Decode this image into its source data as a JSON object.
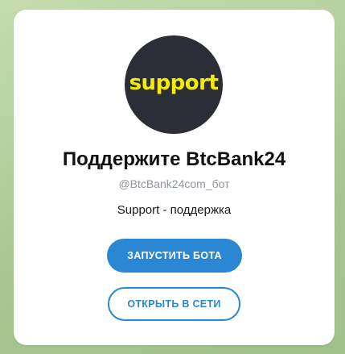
{
  "bot": {
    "avatar_text": "support",
    "title": "Поддержите BtcBank24",
    "username": "@BtcBank24com_бот",
    "description": "Support - поддержка"
  },
  "actions": {
    "start_label": "ЗАПУСТИТЬ БОТА",
    "open_web_label": "ОТКРЫТЬ В СЕТИ"
  },
  "colors": {
    "accent": "#2b87d3",
    "avatar_bg": "#2b2e37",
    "avatar_text": "#f5ec00"
  }
}
